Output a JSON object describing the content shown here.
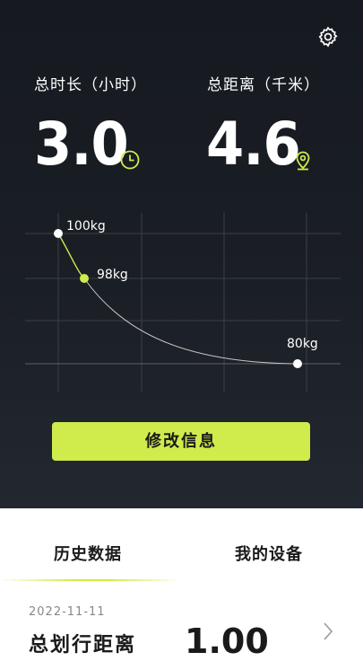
{
  "hero": {
    "total_time_label": "总时长（小时）",
    "total_time_value": "3.0",
    "total_distance_label": "总距离（千米）",
    "total_distance_value": "4.6"
  },
  "chart": {
    "points": [
      {
        "label": "100kg"
      },
      {
        "label": "98kg"
      },
      {
        "label": "80kg"
      }
    ]
  },
  "action_button": "修改信息",
  "tabs": [
    "历史数据",
    "我的设备"
  ],
  "record": {
    "date": "2022-11-11",
    "label": "总划行距离",
    "value": "1.00"
  },
  "colors": {
    "accent": "#cfeb4c",
    "background_dark": "#1a1e25"
  },
  "icons": [
    "gear-icon",
    "clock-icon",
    "location-pin-icon",
    "chevron-right-icon"
  ]
}
